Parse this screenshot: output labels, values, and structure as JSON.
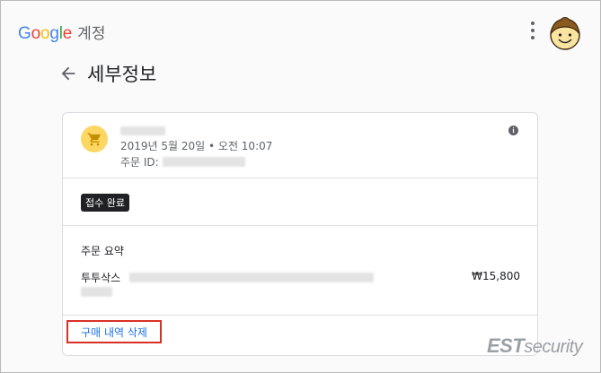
{
  "header": {
    "brand_letters": [
      "G",
      "o",
      "o",
      "g",
      "l",
      "e"
    ],
    "product": "계정"
  },
  "page": {
    "title": "세부정보"
  },
  "order": {
    "date": "2019년 5월 20일 • 오전 10:07",
    "id_label": "주문 ID:",
    "status": "접수 완료",
    "summary_title": "주문 요약",
    "item_name": "투투삭스",
    "item_price": "₩15,800",
    "delete_label": "구매 내역 삭제"
  },
  "watermark": {
    "est": "EST",
    "security": "security"
  },
  "colors": {
    "accent_link": "#1a73e8",
    "highlight_box": "#d93025",
    "merchant_icon_bg": "#fdd663"
  },
  "icons": [
    "more-vert-icon",
    "avatar",
    "arrow-back-icon",
    "shopping-cart-icon",
    "info-icon"
  ]
}
